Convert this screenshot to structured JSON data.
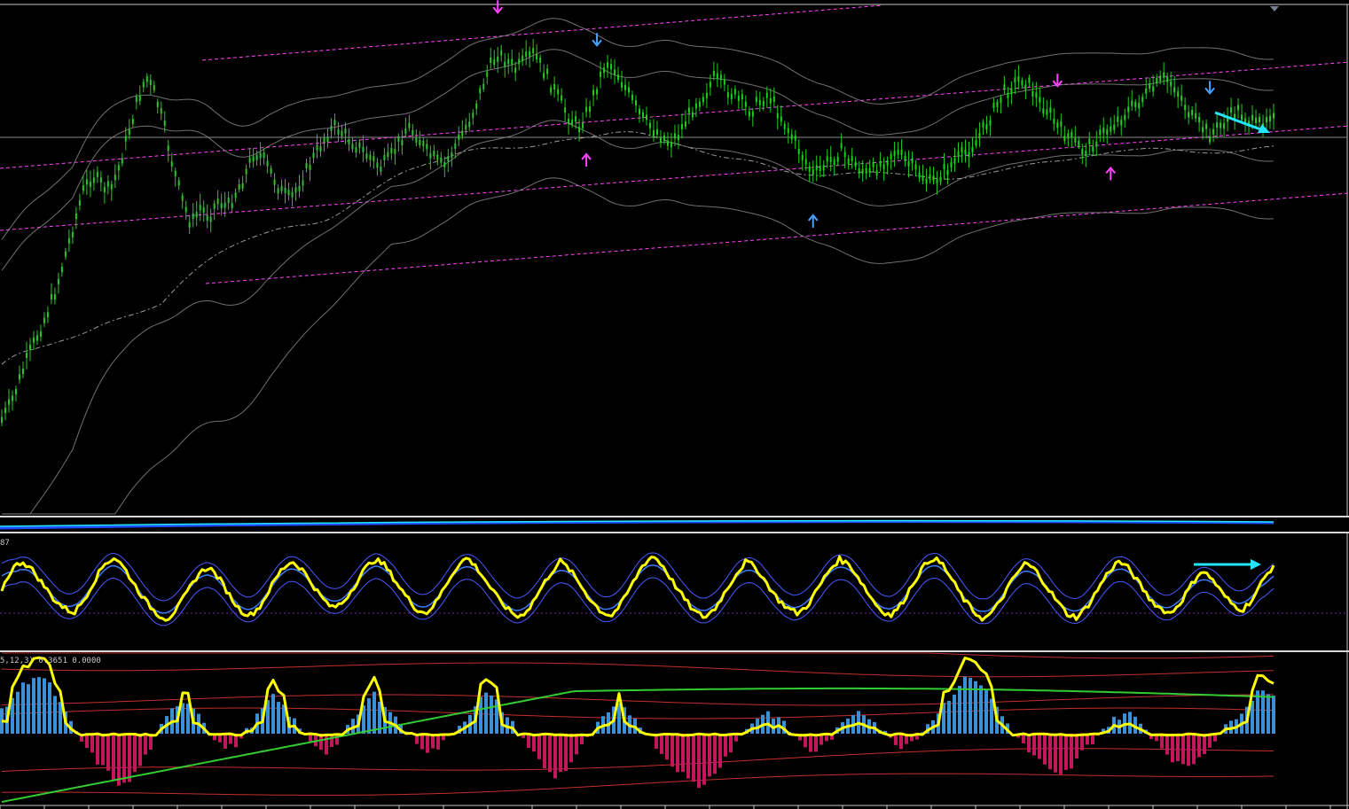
{
  "chart_data": [
    {
      "type": "line",
      "pane": "price",
      "title": "",
      "series": [
        {
          "role": "candles",
          "color": "#22cc22",
          "values": [
            0.1,
            0.14,
            0.2,
            0.26,
            0.31,
            0.36,
            0.42,
            0.5,
            0.58,
            0.66,
            0.7,
            0.68,
            0.66,
            0.72,
            0.8,
            0.88,
            0.94,
            0.9,
            0.82,
            0.72,
            0.64,
            0.58,
            0.62,
            0.6,
            0.64,
            0.62,
            0.66,
            0.7,
            0.76,
            0.74,
            0.7,
            0.66,
            0.64,
            0.68,
            0.72,
            0.76,
            0.8,
            0.82,
            0.8,
            0.78,
            0.76,
            0.74,
            0.72,
            0.74,
            0.78,
            0.82,
            0.8,
            0.76,
            0.74,
            0.72,
            0.76,
            0.8,
            0.84,
            0.9,
            0.96,
            1.0,
            0.98,
            0.96,
            0.98,
            1.0,
            0.96,
            0.92,
            0.88,
            0.84,
            0.82,
            0.86,
            0.92,
            0.98,
            0.96,
            0.92,
            0.88,
            0.84,
            0.82,
            0.8,
            0.78,
            0.8,
            0.84,
            0.88,
            0.9,
            0.94,
            0.92,
            0.9,
            0.88,
            0.86,
            0.88,
            0.9,
            0.86,
            0.82,
            0.78,
            0.74,
            0.7,
            0.72,
            0.74,
            0.76,
            0.74,
            0.72,
            0.7,
            0.72,
            0.74,
            0.76,
            0.74,
            0.72,
            0.7,
            0.68,
            0.7,
            0.72,
            0.74,
            0.76,
            0.78,
            0.82,
            0.86,
            0.9,
            0.92,
            0.94,
            0.92,
            0.88,
            0.86,
            0.82,
            0.8,
            0.78,
            0.76,
            0.78,
            0.8,
            0.82,
            0.84,
            0.86,
            0.88,
            0.9,
            0.92,
            0.94,
            0.92,
            0.88,
            0.84,
            0.82,
            0.8,
            0.82,
            0.84,
            0.86,
            0.84,
            0.82,
            0.84,
            0.86
          ]
        },
        {
          "role": "moving-average",
          "color": "#9a9a9a",
          "style": "dashed"
        },
        {
          "role": "envelope-band",
          "color": "#8c8c8c"
        },
        {
          "role": "channel-lines",
          "color": "#ff44ff",
          "style": "dashed"
        }
      ],
      "markers": [
        {
          "type": "down-arrow",
          "color": "#ff44ff",
          "index": 55
        },
        {
          "type": "down-arrow",
          "color": "#4aa3ff",
          "index": 66
        },
        {
          "type": "up-arrow",
          "color": "#ff44ff",
          "index": 65
        },
        {
          "type": "up-arrow",
          "color": "#4aa3ff",
          "index": 90
        },
        {
          "type": "down-arrow",
          "color": "#ff44ff",
          "index": 117
        },
        {
          "type": "up-arrow",
          "color": "#ff44ff",
          "index": 123
        },
        {
          "type": "down-arrow",
          "color": "#4aa3ff",
          "index": 134
        }
      ],
      "annotation": {
        "type": "trend-arrow",
        "color": "#22e5ff",
        "direction": "down-right"
      }
    },
    {
      "type": "line",
      "pane": "oscillator",
      "label_text": "87",
      "series": [
        {
          "role": "main",
          "color": "#ffff00",
          "values": [
            0.5,
            0.72,
            0.8,
            0.7,
            0.55,
            0.4,
            0.3,
            0.25,
            0.4,
            0.6,
            0.78,
            0.84,
            0.7,
            0.52,
            0.36,
            0.24,
            0.18,
            0.3,
            0.48,
            0.66,
            0.74,
            0.62,
            0.44,
            0.28,
            0.22,
            0.32,
            0.52,
            0.7,
            0.8,
            0.72,
            0.56,
            0.4,
            0.3,
            0.36,
            0.52,
            0.7,
            0.82,
            0.76,
            0.6,
            0.44,
            0.3,
            0.24,
            0.36,
            0.56,
            0.74,
            0.84,
            0.72,
            0.56,
            0.4,
            0.28,
            0.2,
            0.3,
            0.48,
            0.66,
            0.8,
            0.7,
            0.54,
            0.38,
            0.26,
            0.22,
            0.36,
            0.56,
            0.76,
            0.86,
            0.74,
            0.56,
            0.4,
            0.26,
            0.2,
            0.3,
            0.48,
            0.66,
            0.8,
            0.72,
            0.56,
            0.4,
            0.3,
            0.24,
            0.34,
            0.52,
            0.7,
            0.82,
            0.76,
            0.6,
            0.42,
            0.28,
            0.22,
            0.34,
            0.54,
            0.72,
            0.84,
            0.76,
            0.58,
            0.4,
            0.26,
            0.18,
            0.28,
            0.46,
            0.64,
            0.78,
            0.7,
            0.54,
            0.38,
            0.24,
            0.2,
            0.32,
            0.5,
            0.68,
            0.8,
            0.72,
            0.56,
            0.4,
            0.3,
            0.24,
            0.36,
            0.54,
            0.7,
            0.62,
            0.46,
            0.34,
            0.28,
            0.4,
            0.6,
            0.76
          ]
        },
        {
          "role": "signal",
          "color": "#3d7bff"
        },
        {
          "role": "band-upper",
          "color": "#4a58ff"
        },
        {
          "role": "band-lower",
          "color": "#4a58ff"
        },
        {
          "role": "zero-level",
          "color": "#7a1fa2",
          "style": "dotted"
        }
      ],
      "annotation": {
        "type": "trend-arrow",
        "color": "#22e5ff",
        "direction": "right"
      }
    },
    {
      "type": "bar",
      "pane": "macd",
      "label_text": "5,12,3) 0.3651 0.0000",
      "series": [
        {
          "role": "histogram-positive",
          "color": "#3b8fd6"
        },
        {
          "role": "histogram-negative",
          "color": "#c2185b"
        },
        {
          "role": "histogram",
          "values": [
            0.35,
            0.6,
            0.8,
            0.95,
            0.85,
            0.55,
            0.2,
            -0.1,
            -0.35,
            -0.55,
            -0.75,
            -0.85,
            -0.6,
            -0.3,
            0.05,
            0.35,
            0.55,
            0.45,
            0.2,
            -0.1,
            -0.25,
            -0.15,
            0.1,
            0.35,
            0.6,
            0.45,
            0.2,
            -0.05,
            -0.2,
            -0.3,
            -0.1,
            0.15,
            0.4,
            0.65,
            0.5,
            0.25,
            0.05,
            -0.15,
            -0.3,
            -0.2,
            0.0,
            0.2,
            0.45,
            0.65,
            0.5,
            0.25,
            0.0,
            -0.25,
            -0.5,
            -0.7,
            -0.6,
            -0.35,
            -0.1,
            0.15,
            0.35,
            0.45,
            0.3,
            0.1,
            -0.15,
            -0.4,
            -0.55,
            -0.75,
            -0.85,
            -0.7,
            -0.45,
            -0.2,
            0.05,
            0.25,
            0.35,
            0.25,
            0.05,
            -0.15,
            -0.3,
            -0.2,
            0.0,
            0.2,
            0.4,
            0.3,
            0.1,
            -0.1,
            -0.2,
            -0.1,
            0.1,
            0.3,
            0.55,
            0.75,
            0.95,
            0.8,
            0.55,
            0.25,
            0.0,
            -0.25,
            -0.4,
            -0.6,
            -0.7,
            -0.55,
            -0.3,
            -0.1,
            0.1,
            0.25,
            0.35,
            0.2,
            0.0,
            -0.2,
            -0.4,
            -0.55,
            -0.45,
            -0.25,
            -0.05,
            0.15,
            0.35,
            0.55,
            0.75,
            0.6
          ]
        },
        {
          "role": "signal-line",
          "color": "#ffff00"
        },
        {
          "role": "slow-average",
          "color": "#33cc33"
        },
        {
          "role": "bands",
          "color": "#e53935"
        }
      ]
    }
  ]
}
